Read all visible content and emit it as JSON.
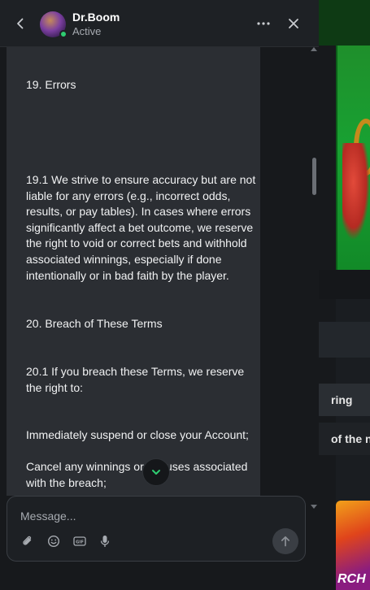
{
  "header": {
    "name": "Dr.Boom",
    "status": "Active"
  },
  "message": {
    "paragraphs": [
      "19. Errors",
      "19.1 We strive to ensure accuracy but are not liable for any errors (e.g., incorrect odds, results, or pay tables). In cases where errors significantly affect a bet outcome, we reserve the right to void or correct bets and withhold associated winnings, especially if done intentionally or in bad faith by the player.",
      "20. Breach of These Terms",
      "20.1 If you breach these Terms, we reserve the right to:",
      "Immediately suspend or close your Account;",
      "Cancel any winnings or bonuses associated with the breach;"
    ]
  },
  "composer": {
    "placeholder": "Message..."
  },
  "background": {
    "text_1": "ring",
    "text_2": "of the n",
    "thumb_text": "RCH"
  },
  "colors": {
    "online": "#2ecc71",
    "jump_arrow": "#2ecc71",
    "bubble": "#2b2e33",
    "panel": "#17191c"
  },
  "icons": [
    "back-arrow-icon",
    "more-horizontal-icon",
    "close-icon",
    "chevron-down-icon",
    "paperclip-icon",
    "emoji-icon",
    "gif-icon",
    "microphone-icon",
    "arrow-up-icon"
  ]
}
